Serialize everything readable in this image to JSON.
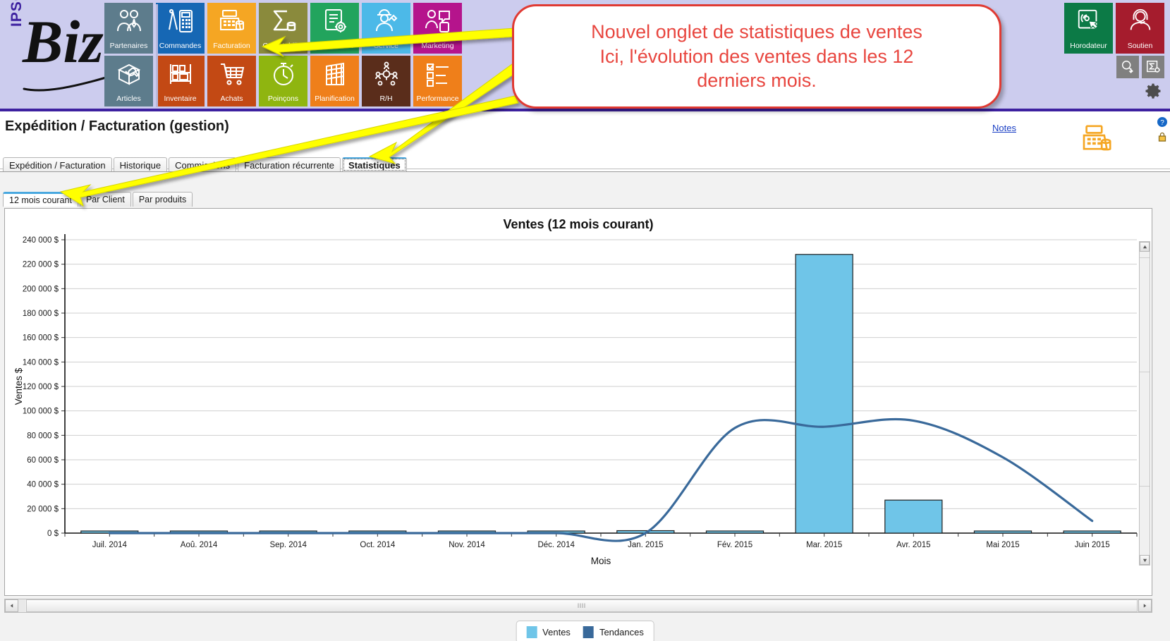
{
  "app": {
    "logo_ipso": "IPSO",
    "logo_biz": "Biz"
  },
  "toolbar": {
    "row1": [
      {
        "label": "Partenaires",
        "icon": "people-icon",
        "color": "#5d7c8c"
      },
      {
        "label": "Commandes",
        "icon": "compass-calculator-icon",
        "color": "#1667b4"
      },
      {
        "label": "Facturation",
        "icon": "cash-register-icon",
        "color": "#f5a623"
      },
      {
        "label": "Comptabilité",
        "icon": "sigma-coins-icon",
        "color": "#8a8a3c"
      },
      {
        "label": "Fabrication",
        "icon": "clipboard-gear-icon",
        "color": "#22a45d"
      },
      {
        "label": "Service",
        "icon": "worker-wrench-icon",
        "color": "#4cb9e8"
      },
      {
        "label": "Marketing",
        "icon": "speech-people-icon",
        "color": "#b5148c"
      }
    ],
    "row2": [
      {
        "label": "Articles",
        "icon": "box-wrench-icon",
        "color": "#5d7c8c"
      },
      {
        "label": "Inventaire",
        "icon": "shelf-icon",
        "color": "#c34914"
      },
      {
        "label": "Achats",
        "icon": "shopping-cart-icon",
        "color": "#c34914"
      },
      {
        "label": "Poinçons",
        "icon": "stopwatch-icon",
        "color": "#8fb510"
      },
      {
        "label": "Planification",
        "icon": "calendar-icon",
        "color": "#ef7f1a"
      },
      {
        "label": "R/H",
        "icon": "org-chart-icon",
        "color": "#5a2d1b"
      },
      {
        "label": "Performance",
        "icon": "checklist-icon",
        "color": "#ef7f1a"
      }
    ],
    "right": [
      {
        "label": "Horodateur",
        "icon": "touch-screen-icon",
        "color": "#0c7a46"
      },
      {
        "label": "Soutien",
        "icon": "headset-support-icon",
        "color": "#a51c2d"
      }
    ],
    "right_small": [
      {
        "icon": "search-download-icon"
      },
      {
        "icon": "sigma-settings-icon"
      },
      {
        "icon": "gear-icon"
      }
    ]
  },
  "callout": {
    "text": "Nouvel onglet de statistiques de ventes\nIci, l'évolution des ventes dans les 12\nderniers mois.",
    "border_color": "#e03a33",
    "text_color": "#e8463f",
    "arrow_color": "#ffff00"
  },
  "header": {
    "title": "Expédition / Facturation (gestion)",
    "notes_link": "Notes",
    "cash_icon": "cash-register-icon",
    "side_icons": [
      "help-globe-icon",
      "lock-icon"
    ]
  },
  "main_tabs": [
    {
      "label": "Expédition / Facturation",
      "active": false
    },
    {
      "label": "Historique",
      "active": false
    },
    {
      "label": "Commissions",
      "active": false
    },
    {
      "label": "Facturation récurrente",
      "active": false
    },
    {
      "label": "Statistiques",
      "active": true
    }
  ],
  "sub_tabs": [
    {
      "label": "12 mois courant",
      "active": true
    },
    {
      "label": "Par Client",
      "active": false
    },
    {
      "label": "Par produits",
      "active": false
    }
  ],
  "scroll": {
    "left_arrow": "◄",
    "right_arrow": "►",
    "grip": "llll",
    "up_arrow": "▲",
    "down_arrow": "▼"
  },
  "legend": {
    "items": [
      {
        "label": "Ventes",
        "color": "#6fc5e8"
      },
      {
        "label": "Tendances",
        "color": "#39699a"
      }
    ]
  },
  "chart_data": {
    "type": "bar",
    "title": "Ventes (12 mois courant)",
    "xlabel": "Mois",
    "ylabel": "Ventes $",
    "grid": true,
    "legend_position": "bottom",
    "categories": [
      "Juil. 2014",
      "Aoû. 2014",
      "Sep. 2014",
      "Oct. 2014",
      "Nov. 2014",
      "Déc. 2014",
      "Jan. 2015",
      "Fév. 2015",
      "Mar. 2015",
      "Avr. 2015",
      "Mai 2015",
      "Juin 2015"
    ],
    "ytick_labels": [
      "0 $",
      "20 000 $",
      "40 000 $",
      "60 000 $",
      "80 000 $",
      "100 000 $",
      "120 000 $",
      "140 000 $",
      "160 000 $",
      "180 000 $",
      "200 000 $",
      "220 000 $",
      "240 000 $"
    ],
    "ytick_values": [
      0,
      20000,
      40000,
      60000,
      80000,
      100000,
      120000,
      140000,
      160000,
      180000,
      200000,
      220000,
      240000
    ],
    "ylim": [
      0,
      240000
    ],
    "series": [
      {
        "name": "Ventes",
        "type": "bar",
        "color": "#6fc5e8",
        "edge_color": "#1f1f1f",
        "values": [
          0,
          0,
          0,
          0,
          0,
          0,
          2000,
          1500,
          228000,
          27000,
          1200,
          0
        ]
      },
      {
        "name": "Tendances",
        "type": "line",
        "color": "#39699a",
        "values": [
          0,
          0,
          0,
          0,
          0,
          0,
          0,
          86000,
          87000,
          92000,
          62000,
          10000
        ]
      }
    ]
  }
}
